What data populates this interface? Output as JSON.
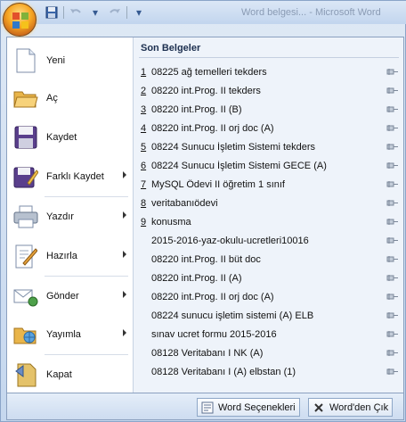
{
  "title_bar": {
    "text": "Word belgesi... - Microsoft Word",
    "qat": [
      "save-icon",
      "undo-icon",
      "redo-icon",
      "customize-icon"
    ]
  },
  "menu": {
    "items": [
      {
        "label": "Yeni",
        "icon": "new-document-icon",
        "submenu": false
      },
      {
        "label": "Aç",
        "icon": "open-folder-icon",
        "submenu": false
      },
      {
        "label": "Kaydet",
        "icon": "save-disk-icon",
        "submenu": false
      },
      {
        "label": "Farklı Kaydet",
        "icon": "save-as-icon",
        "submenu": true
      },
      {
        "label": "Yazdır",
        "icon": "print-icon",
        "submenu": true
      },
      {
        "label": "Hazırla",
        "icon": "prepare-icon",
        "submenu": true
      },
      {
        "label": "Gönder",
        "icon": "send-icon",
        "submenu": true
      },
      {
        "label": "Yayımla",
        "icon": "publish-icon",
        "submenu": true
      },
      {
        "label": "Kapat",
        "icon": "close-document-icon",
        "submenu": false
      }
    ]
  },
  "recent": {
    "heading": "Son Belgeler",
    "items": [
      {
        "num": "1",
        "name": "08225 ağ temelleri tekders"
      },
      {
        "num": "2",
        "name": "08220 int.Prog. II tekders"
      },
      {
        "num": "3",
        "name": "08220 int.Prog. II  (B)"
      },
      {
        "num": "4",
        "name": "08220 int.Prog. II  orj doc (A)"
      },
      {
        "num": "5",
        "name": "08224 Sunucu İşletim Sistemi tekders"
      },
      {
        "num": "6",
        "name": "08224 Sunucu İşletim Sistemi GECE (A)"
      },
      {
        "num": "7",
        "name": "MySQL Ödevi II öğretim 1 sınıf"
      },
      {
        "num": "8",
        "name": "veritabanıödevi"
      },
      {
        "num": "9",
        "name": "konusma"
      },
      {
        "num": "",
        "name": "2015-2016-yaz-okulu-ucretleri10016"
      },
      {
        "num": "",
        "name": "08220 int.Prog. II  büt doc"
      },
      {
        "num": "",
        "name": "08220 int.Prog. II  (A)"
      },
      {
        "num": "",
        "name": "08220 int.Prog. II  orj doc (A)"
      },
      {
        "num": "",
        "name": "08224 sunucu işletim sistemi  (A) ELB"
      },
      {
        "num": "",
        "name": "sınav ucret formu 2015-2016"
      },
      {
        "num": "",
        "name": "08128 Veritabanı I NK (A)"
      },
      {
        "num": "",
        "name": "08128 Veritabanı I (A) elbstan (1)"
      }
    ]
  },
  "buttons": {
    "options": "Word Seçenekleri",
    "exit": "Word'den Çık"
  }
}
